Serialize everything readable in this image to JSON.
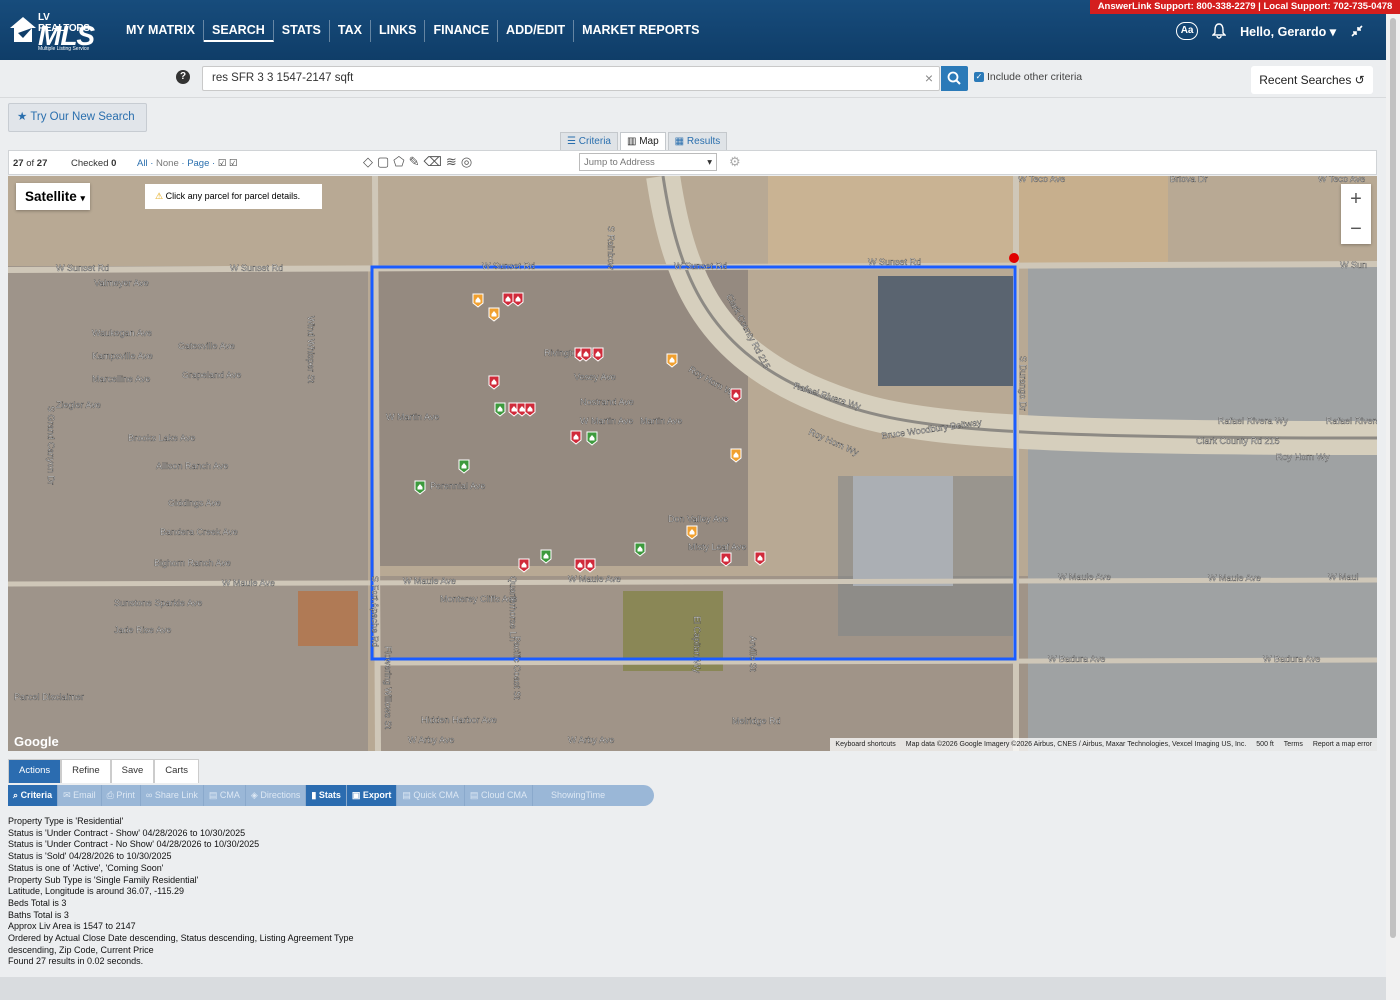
{
  "support": "AnswerLink Support: 800-338-2279 | Local Support: 702-735-0478",
  "logo": {
    "top": "LV REALTORS",
    "main": "MLS",
    "tag": "Multiple Listing Service"
  },
  "nav": {
    "items": [
      "MY MATRIX",
      "SEARCH",
      "STATS",
      "TAX",
      "LINKS",
      "FINANCE",
      "ADD/EDIT",
      "MARKET REPORTS"
    ],
    "aa": "Aa",
    "hello": "Hello, Gerardo"
  },
  "search": {
    "help": "?",
    "value": "res SFR 3 3 1547-2147 sqft",
    "include_label": "Include other criteria",
    "recent": "Recent Searches"
  },
  "try_new": "Try Our New Search",
  "view_tabs": {
    "criteria": "Criteria",
    "map": "Map",
    "results": "Results"
  },
  "toolbar": {
    "shown": "27",
    "of": "of",
    "total": "27",
    "checked_label": "Checked",
    "checked": "0",
    "all": "All",
    "none": "None",
    "page": "Page",
    "jump": "Jump to Address"
  },
  "map": {
    "view": "Satellite",
    "hint": "Click any parcel for parcel details.",
    "attribution": "Map data ©2026 Google Imagery ©2026 Airbus, CNES / Airbus, Maxar Technologies, Vexcel Imaging US, Inc.",
    "shortcuts": "Keyboard shortcuts",
    "scale": "500 ft",
    "terms": "Terms",
    "report": "Report a map error",
    "google": "Google",
    "roads": [
      "W Sunset Rd",
      "W Sunset Rd",
      "W Sunset Rd",
      "W Sunset Rd",
      "W Sunset Rd",
      "W Sun",
      "W Martin Ave",
      "Martin Ave",
      "W Martin Ave",
      "W Maule Ave",
      "W Maule Ave",
      "W Maule Ave",
      "W Maule Ave",
      "W Maule Ave",
      "W Maul",
      "W Arby Ave",
      "W Arby Ave",
      "W Badura Ave",
      "W Badura Ave",
      "Bruce Woodbury Beltway",
      "Clark County Rd 215",
      "Clark County Rd 215",
      "Rafael Rivera Wy",
      "Rafael Rivera Wy",
      "Rafael Rivera",
      "Roy Horn Wy",
      "Roy Horn Wy",
      "Roy Horn Wy",
      "S Durango Dr",
      "S Fort Apache Rd",
      "S Grand Canyon Dr",
      "W Teco Ave",
      "W Teco Ave",
      "Briova Dr",
      "Valmeyer Ave",
      "Waukegan Ave",
      "Kampsville Ave",
      "Marcelline Ave",
      "Ziegler Ave",
      "Gatesville Ave",
      "Grapeland Ave",
      "Brooks Lake Ave",
      "Allison Ranch Ave",
      "Giddings Ave",
      "Bandera Creek Ave",
      "Bighorn Ranch Ave",
      "Sunstone Sparkle Ave",
      "Jade Rise Ave",
      "Rivington Ave",
      "Vesey Ave",
      "Nostrand Ave",
      "Perennial Ave",
      "Don Valley Ave",
      "Misty Leaf Ave",
      "Monterey Cliffs Ave",
      "Hidden Harbor Ave",
      "Melridge Rd",
      "Parcel Disclaimer",
      "Wind Whisper St",
      "S Rainbow",
      "Pacific Coast St",
      "Quarterhorse Ln",
      "Flowering Willows St",
      "El Capitan Wy",
      "Arville St"
    ]
  },
  "action_tabs": [
    "Actions",
    "Refine",
    "Save",
    "Carts"
  ],
  "action_buttons": [
    "Criteria",
    "Email",
    "Print",
    "Share Link",
    "CMA",
    "Directions",
    "Stats",
    "Export",
    "Quick CMA",
    "Cloud CMA",
    "ShowingTime"
  ],
  "criteria_lines": [
    "Property Type is 'Residential'",
    "Status is 'Under Contract - Show' 04/28/2026 to 10/30/2025",
    "Status is 'Under Contract - No Show' 04/28/2026 to 10/30/2025",
    "Status is 'Sold' 04/28/2026 to 10/30/2025",
    "Status is one of 'Active', 'Coming Soon'",
    "Property Sub Type is 'Single Family Residential'",
    "Latitude, Longitude is around 36.07, -115.29",
    "Beds Total is 3",
    "Baths Total is 3",
    "Approx Liv Area is 1547 to 2147",
    "Ordered by Actual Close Date descending, Status descending, Listing Agreement Type",
    "descending, Zip Code, Current Price",
    "Found 27 results in 0.02 seconds."
  ],
  "colors": {
    "nav": "#174c7c",
    "accent": "#2b6cb0",
    "support": "#d41e1e",
    "sold": "#d02a3a",
    "active": "#3d9a3d",
    "pending": "#f0a030",
    "boundary": "#1a5cff"
  }
}
